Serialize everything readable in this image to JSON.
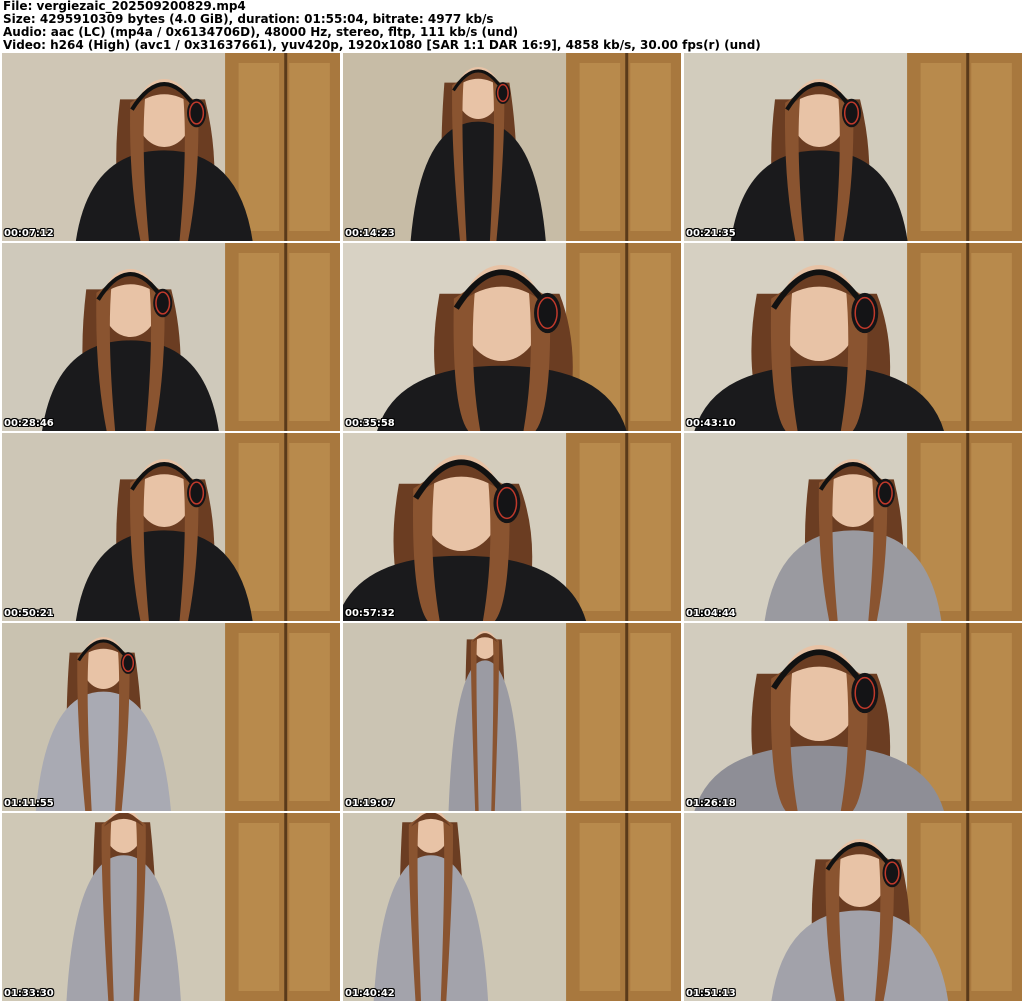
{
  "header": {
    "file_line": "File: vergiezaic_202509200829.mp4",
    "size_line": "Size: 4295910309 bytes (4.0 GiB), duration: 01:55:04, bitrate: 4977 kb/s",
    "audio_line": "Audio: aac (LC) (mp4a / 0x6134706D), 48000 Hz, stereo, fltp, 111 kb/s (und)",
    "video_line": "Video: h264 (High) (avc1 / 0x31637661), yuv420p, 1920x1080 [SAR 1:1 DAR 16:9], 4858 kb/s, 30.00 fps(r) (und)"
  },
  "thumbnails": [
    {
      "timestamp": "00:07:12",
      "scene": "closeup",
      "shirt": "#1a1a1c",
      "bg": "#cfc6b5",
      "face_x": 0.48
    },
    {
      "timestamp": "00:14:23",
      "scene": "leaning",
      "shirt": "#1a1a1c",
      "bg": "#c7bca6",
      "face_x": 0.4
    },
    {
      "timestamp": "00:21:35",
      "scene": "closeup",
      "shirt": "#1a1a1c",
      "bg": "#d2ccbd",
      "face_x": 0.4
    },
    {
      "timestamp": "00:28:46",
      "scene": "closeup",
      "shirt": "#1a1a1c",
      "bg": "#cfc9bb",
      "face_x": 0.38
    },
    {
      "timestamp": "00:35:58",
      "scene": "face",
      "shirt": "#1a1a1c",
      "bg": "#d8d2c4",
      "face_x": 0.47
    },
    {
      "timestamp": "00:43:10",
      "scene": "face",
      "shirt": "#1a1a1c",
      "bg": "#d6d0c2",
      "face_x": 0.4
    },
    {
      "timestamp": "00:50:21",
      "scene": "closeup",
      "shirt": "#1a1a1c",
      "bg": "#cdc6b6",
      "face_x": 0.48
    },
    {
      "timestamp": "00:57:32",
      "scene": "face",
      "shirt": "#1a1a1c",
      "bg": "#d4cdbd",
      "face_x": 0.35
    },
    {
      "timestamp": "01:04:44",
      "scene": "closeup",
      "shirt": "#9a9aa0",
      "bg": "#d4cfc1",
      "face_x": 0.5
    },
    {
      "timestamp": "01:11:55",
      "scene": "leaning",
      "shirt": "#a9aab3",
      "bg": "#c9c2b0",
      "face_x": 0.3
    },
    {
      "timestamp": "01:19:07",
      "scene": "standing",
      "shirt": "#9b9ba3",
      "bg": "#cbc4b3",
      "face_x": 0.42
    },
    {
      "timestamp": "01:26:18",
      "scene": "face",
      "shirt": "#8e8e96",
      "bg": "#d2ccbe",
      "face_x": 0.4
    },
    {
      "timestamp": "01:33:30",
      "scene": "bending",
      "shirt": "#a3a3ab",
      "bg": "#cfc8b6",
      "face_x": 0.36
    },
    {
      "timestamp": "01:40:42",
      "scene": "bending",
      "shirt": "#a3a3ab",
      "bg": "#cdc6b4",
      "face_x": 0.26
    },
    {
      "timestamp": "01:51:13",
      "scene": "waving",
      "shirt": "#a2a2aa",
      "bg": "#d3cdbe",
      "face_x": 0.52
    }
  ]
}
